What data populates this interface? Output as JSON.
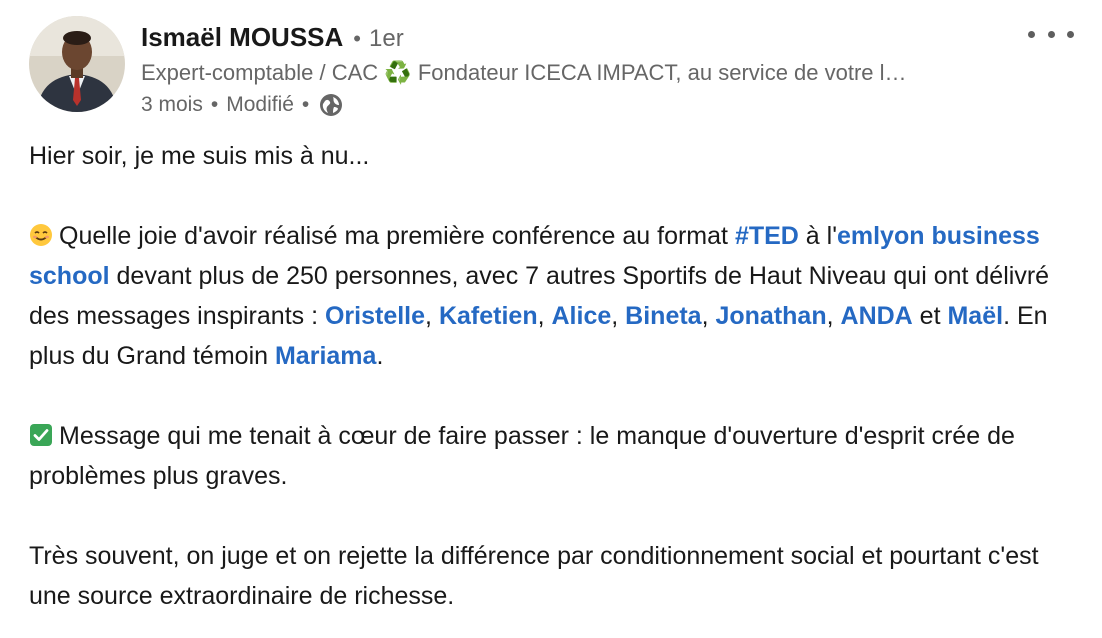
{
  "author": {
    "name": "Ismaël MOUSSA",
    "degree": "1er",
    "headline_part1": "Expert-comptable / CAC",
    "headline_icon": "recycle-icon",
    "headline_part2": "Fondateur ICECA IMPACT, au service de votre l…",
    "time": "3 mois",
    "edited": "Modifié",
    "visibility_icon": "globe-icon"
  },
  "menu": {
    "icon": "more-horizontal-icon"
  },
  "post": {
    "line1": "Hier soir, je me suis mis à nu...",
    "p2_icon": "smiling-face-icon",
    "p2_t1": "Quelle joie d'avoir réalisé ma première conférence au format ",
    "p2_l1": "#TED",
    "p2_t2": " à l'",
    "p2_l2": "emlyon business school",
    "p2_t3": " devant plus de 250 personnes, avec 7 autres Sportifs de Haut Niveau qui ont délivré des messages inspirants : ",
    "p2_l3": "Oristelle",
    "p2_c1": ", ",
    "p2_l4": "Kafetien",
    "p2_c2": ", ",
    "p2_l5": "Alice",
    "p2_c3": ", ",
    "p2_l6": "Bineta",
    "p2_c4": ", ",
    "p2_l7": "Jonathan",
    "p2_c5": ", ",
    "p2_l8": "ANDA",
    "p2_t4": " et ",
    "p2_l9": "Maël",
    "p2_t5": ". En plus du Grand témoin ",
    "p2_l10": "Mariama",
    "p2_t6": ".",
    "p3_icon": "check-mark-icon",
    "p3_text": "Message qui me tenait à cœur de faire passer : le manque d'ouverture d'esprit crée de problèmes plus graves.",
    "p4_text": "Très souvent, on juge et on rejette la différence par conditionnement social et pourtant c'est une source extraordinaire de richesse."
  },
  "colors": {
    "link": "#2569c3",
    "secondary_text": "#666666",
    "check_green": "#3aa657"
  }
}
